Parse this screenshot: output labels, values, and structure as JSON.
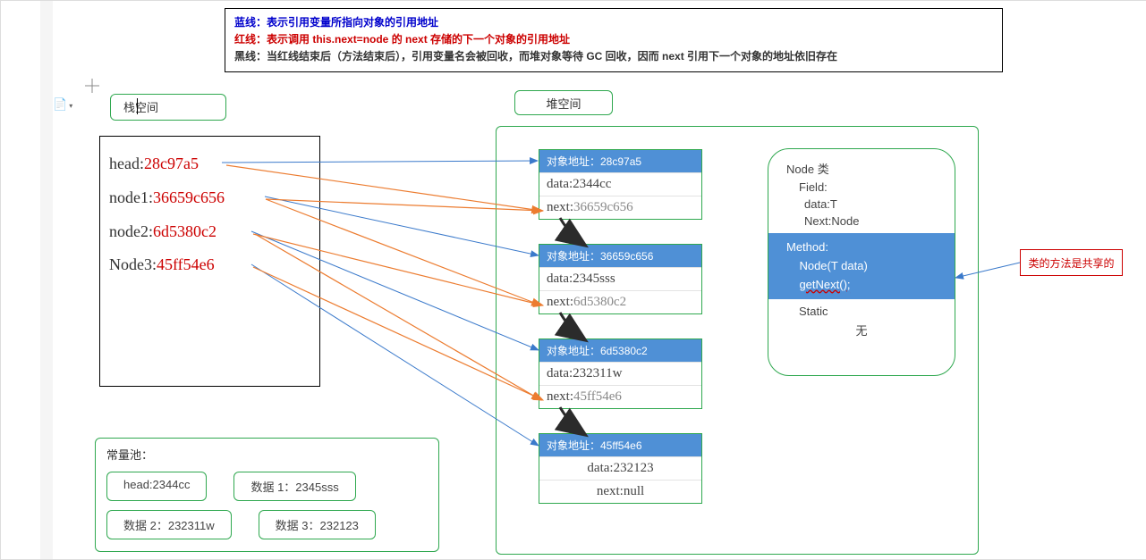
{
  "legend": {
    "blue": "蓝线：表示引用变量所指向对象的引用地址",
    "red_prefix": "红线：表示调用 ",
    "red_bold": "this.next=node",
    "red_mid": " 的 ",
    "red_bold2": "next",
    "red_suffix": " 存储的下一个对象的引用地址",
    "black_a": "黑线：当红线结束后（方法结束后），引用变量名会被回收，而堆对象等待 ",
    "black_gc": "GC",
    "black_b": " 回收，因而 ",
    "black_next": "next",
    "black_c": " 引用下一个对象的地址依旧存在"
  },
  "labels": {
    "stack": "栈空间",
    "heap": "堆空间",
    "const": "常量池："
  },
  "stack": [
    {
      "name": "head:",
      "addr": "28c97a5"
    },
    {
      "name": "node1:",
      "addr": "36659c656"
    },
    {
      "name": "node2:",
      "addr": "6d5380c2"
    },
    {
      "name": "Node3:",
      "addr": "45ff54e6"
    }
  ],
  "heap": [
    {
      "title": "对象地址：28c97a5",
      "data": "data:2344cc",
      "next_lbl": "next:",
      "next_val": "36659c656"
    },
    {
      "title": "对象地址：36659c656",
      "data": "data:2345sss",
      "next_lbl": "next:",
      "next_val": "6d5380c2"
    },
    {
      "title": "对象地址：6d5380c2",
      "data": "data:232311w",
      "next_lbl": "next:",
      "next_val": "45ff54e6"
    },
    {
      "title": "对象地址：45ff54e6",
      "data": "data:232123",
      "next": "next:null"
    }
  ],
  "class": {
    "title": "Node 类",
    "field": "Field:",
    "f1": "data:T",
    "f2": "Next:Node",
    "method": "Method:",
    "m1": "Node(T data)",
    "m2": "getNext();",
    "static": "Static",
    "none": "无"
  },
  "tip": "类的方法是共享的",
  "consts": {
    "r1c1": "head:2344cc",
    "r1c2": "数据 1：2345sss",
    "r2c1": "数据 2：232311w",
    "r2c2": "数据 3：232123"
  },
  "arrow_style": {
    "blue": "#3b7acb",
    "orange": "#ec7c30",
    "black": "#2b2b2b"
  }
}
